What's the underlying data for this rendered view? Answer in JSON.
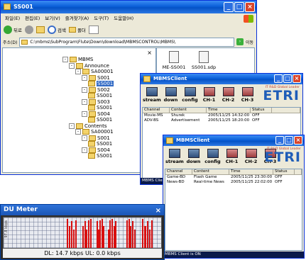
{
  "explorer": {
    "title": "SS001",
    "menu": [
      "파일(E)",
      "편집(E)",
      "보기(V)",
      "즐겨찾기(A)",
      "도구(T)",
      "도움말(H)"
    ],
    "toolbar": {
      "back": "뒤로",
      "search": "검색",
      "folders": "폴더"
    },
    "address": {
      "label": "주소(D)",
      "path": "C:\\mbms\\SubProgram\\Flute\\Down\\download\\MBMSCONTROL\\MBMS\\",
      "go": "이동"
    },
    "tree": [
      {
        "label": "MBMS",
        "indent": 0,
        "exp": "-"
      },
      {
        "label": "Announce",
        "indent": 1,
        "exp": "-"
      },
      {
        "label": "SA00001",
        "indent": 2,
        "exp": "-"
      },
      {
        "label": "S001",
        "indent": 3,
        "exp": "-"
      },
      {
        "label": "SS001",
        "indent": 4,
        "exp": "",
        "selected": true
      },
      {
        "label": "S002",
        "indent": 3,
        "exp": "-"
      },
      {
        "label": "SS001",
        "indent": 4,
        "exp": ""
      },
      {
        "label": "S003",
        "indent": 3,
        "exp": "-"
      },
      {
        "label": "SS001",
        "indent": 4,
        "exp": ""
      },
      {
        "label": "S004",
        "indent": 3,
        "exp": "-"
      },
      {
        "label": "SS001",
        "indent": 4,
        "exp": ""
      },
      {
        "label": "Contents",
        "indent": 1,
        "exp": "-"
      },
      {
        "label": "SA00001",
        "indent": 2,
        "exp": "-"
      },
      {
        "label": "S001",
        "indent": 3,
        "exp": "-"
      },
      {
        "label": "SS001",
        "indent": 4,
        "exp": ""
      },
      {
        "label": "S004",
        "indent": 3,
        "exp": "-"
      },
      {
        "label": "SS001",
        "indent": 4,
        "exp": ""
      }
    ],
    "files": [
      "ME-SS001",
      "SS001.sdp"
    ]
  },
  "client1": {
    "title": "MBMSClient",
    "buttons": [
      "stream",
      "down",
      "config",
      "CH-1",
      "CH-2",
      "CH-3"
    ],
    "brand_tag": "IT R&D Global Leader",
    "brand": "ETRI",
    "columns": [
      "Channel",
      "Content",
      "Time",
      "Status"
    ],
    "rows": [
      {
        "channel": "Movie-MS",
        "content": "Shurek",
        "time": "2005/11/25 14:32:00",
        "status": "OFF"
      },
      {
        "channel": "ADV-BS",
        "content": "Advertisement",
        "time": "2005/11/25 18:20:00",
        "status": "OFF"
      }
    ],
    "status": "MBMS Client"
  },
  "client2": {
    "title": "MBMSClient",
    "buttons": [
      "stream",
      "down",
      "config",
      "CH-1",
      "CH-2",
      "CH-3"
    ],
    "brand_tag": "IT R&D Global Leader",
    "brand": "ETRI",
    "columns": [
      "Channel",
      "Content",
      "Time",
      "Status"
    ],
    "rows": [
      {
        "channel": "Game-BD",
        "content": "Flash Game",
        "time": "2005/11/25 23:30:00",
        "status": "OFF"
      },
      {
        "channel": "News-BD",
        "content": "Real-time News",
        "time": "2005/11/25 22:02:00",
        "status": "OFF"
      }
    ],
    "status": "MBMS Client is ON"
  },
  "dumeter": {
    "title": "DU Meter",
    "ylabel": "97.8 kbps",
    "status": "DL: 14.7 kbps  UL: 0.0 kbps"
  },
  "colors": {
    "accent": "#0a5fd8",
    "bar": "#d80f0f",
    "brand_blue": "#1f5db8",
    "brand_red": "#e0232b"
  }
}
